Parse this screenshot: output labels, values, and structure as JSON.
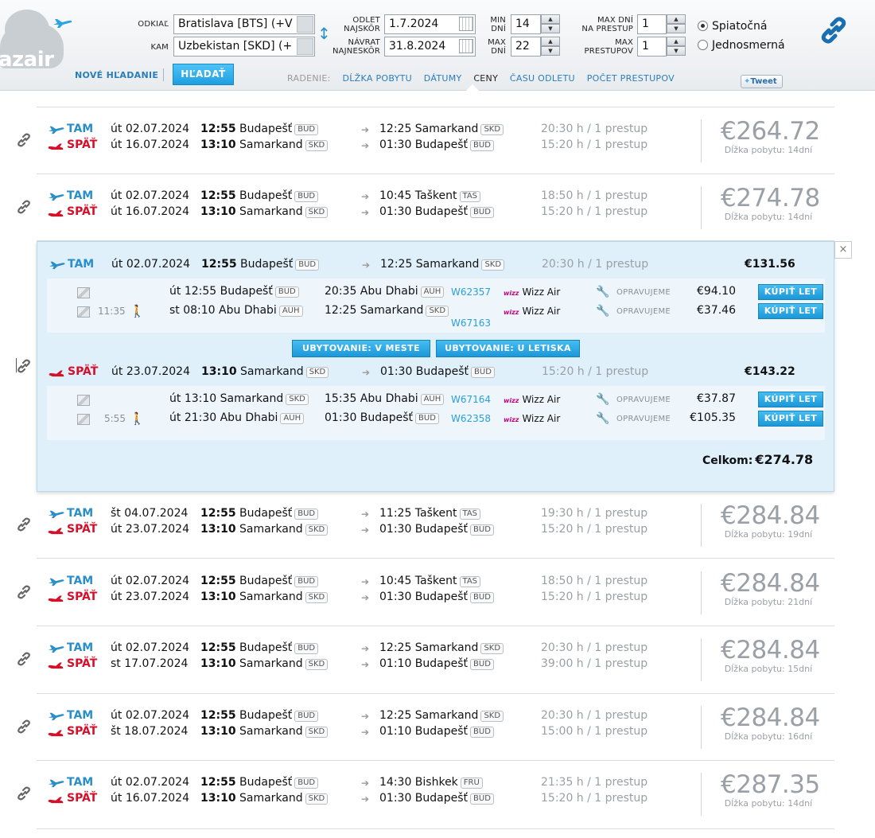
{
  "brand": {
    "logo_text": "azair"
  },
  "search": {
    "from_label": "ODKIAĽ",
    "from_value": "Bratislava [BTS] (+V",
    "to_label": "KAM",
    "to_value": "Uzbekistan [SKD] (+",
    "depart_label": [
      "ODLET",
      "NAJSKÔR"
    ],
    "depart_value": "1.7.2024",
    "return_label": [
      "NÁVRAT",
      "NAJNESKÔR"
    ],
    "return_value": "31.8.2024",
    "min_days_label": [
      "MIN",
      "DNÍ"
    ],
    "min_days_value": "14",
    "max_days_label": [
      "MAX",
      "DNÍ"
    ],
    "max_days_value": "22",
    "max_days_transfer_label": [
      "MAX DNÍ",
      "NA PRESTUP"
    ],
    "max_days_transfer_value": "1",
    "max_transfers_label": [
      "MAX",
      "PRESTUPOV"
    ],
    "max_transfers_value": "1",
    "trip_options": [
      "Spiatočná",
      "Jednosmerná"
    ],
    "trip_selected": "Spiatočná",
    "new_search": "NOVÉ HĽADANIE",
    "search_button": "HĽADAŤ"
  },
  "sorting": {
    "label": "RADENIE:",
    "items": [
      "DĹŽKA POBYTU",
      "DÁTUMY",
      "CENY",
      "ČASU ODLETU",
      "POČET PRESTUPOV"
    ],
    "active": "CENY"
  },
  "tweet": "Tweet",
  "labels": {
    "tam": "TAM",
    "spat": "SPÄŤ",
    "stay_prefix": "Dĺžka pobytu:",
    "fix": "OPRAVUJEME",
    "buy": "KÚPIŤ LET",
    "total": "Celkom:"
  },
  "results": [
    {
      "price": "€264.72",
      "stay": "Dĺžka pobytu: 14dní",
      "out": {
        "date": "út 02.07.2024",
        "time": "12:55",
        "from": "Budapešť",
        "from_code": "BUD",
        "arr": "12:25 Samarkand",
        "arr_code": "SKD",
        "dur": "20:30 h / 1 prestup"
      },
      "ret": {
        "date": "út 16.07.2024",
        "time": "13:10",
        "from": "Samarkand",
        "from_code": "SKD",
        "arr": "01:30 Budapešť",
        "arr_code": "BUD",
        "dur": "15:20 h / 1 prestup"
      }
    },
    {
      "price": "€274.78",
      "stay": "Dĺžka pobytu: 14dní",
      "out": {
        "date": "út 02.07.2024",
        "time": "12:55",
        "from": "Budapešť",
        "from_code": "BUD",
        "arr": "10:45 Taškent",
        "arr_code": "TAS",
        "dur": "18:50 h / 1 prestup"
      },
      "ret": {
        "date": "út 16.07.2024",
        "time": "13:10",
        "from": "Samarkand",
        "from_code": "SKD",
        "arr": "01:30 Budapešť",
        "arr_code": "BUD",
        "dur": "15:20 h / 1 prestup"
      }
    },
    {
      "price": "€284.84",
      "stay": "Dĺžka pobytu: 19dní",
      "out": {
        "date": "št 04.07.2024",
        "time": "12:55",
        "from": "Budapešť",
        "from_code": "BUD",
        "arr": "11:25 Taškent",
        "arr_code": "TAS",
        "dur": "19:30 h / 1 prestup"
      },
      "ret": {
        "date": "út 23.07.2024",
        "time": "13:10",
        "from": "Samarkand",
        "from_code": "SKD",
        "arr": "01:30 Budapešť",
        "arr_code": "BUD",
        "dur": "15:20 h / 1 prestup"
      }
    },
    {
      "price": "€284.84",
      "stay": "Dĺžka pobytu: 21dní",
      "out": {
        "date": "út 02.07.2024",
        "time": "12:55",
        "from": "Budapešť",
        "from_code": "BUD",
        "arr": "10:45 Taškent",
        "arr_code": "TAS",
        "dur": "18:50 h / 1 prestup"
      },
      "ret": {
        "date": "út 23.07.2024",
        "time": "13:10",
        "from": "Samarkand",
        "from_code": "SKD",
        "arr": "01:30 Budapešť",
        "arr_code": "BUD",
        "dur": "15:20 h / 1 prestup"
      }
    },
    {
      "price": "€284.84",
      "stay": "Dĺžka pobytu: 15dní",
      "out": {
        "date": "út 02.07.2024",
        "time": "12:55",
        "from": "Budapešť",
        "from_code": "BUD",
        "arr": "12:25 Samarkand",
        "arr_code": "SKD",
        "dur": "20:30 h / 1 prestup"
      },
      "ret": {
        "date": "st 17.07.2024",
        "time": "13:10",
        "from": "Samarkand",
        "from_code": "SKD",
        "arr": "01:10 Budapešť",
        "arr_code": "BUD",
        "dur": "39:00 h / 1 prestup"
      }
    },
    {
      "price": "€284.84",
      "stay": "Dĺžka pobytu: 16dní",
      "out": {
        "date": "út 02.07.2024",
        "time": "12:55",
        "from": "Budapešť",
        "from_code": "BUD",
        "arr": "12:25 Samarkand",
        "arr_code": "SKD",
        "dur": "20:30 h / 1 prestup"
      },
      "ret": {
        "date": "št 18.07.2024",
        "time": "13:10",
        "from": "Samarkand",
        "from_code": "SKD",
        "arr": "01:10 Budapešť",
        "arr_code": "BUD",
        "dur": "15:00 h / 1 prestup"
      }
    },
    {
      "price": "€287.35",
      "stay": "Dĺžka pobytu: 14dní",
      "out": {
        "date": "út 02.07.2024",
        "time": "12:55",
        "from": "Budapešť",
        "from_code": "BUD",
        "arr": "14:30 Bishkek",
        "arr_code": "FRU",
        "dur": "21:35 h / 1 prestup"
      },
      "ret": {
        "date": "út 16.07.2024",
        "time": "13:10",
        "from": "Samarkand",
        "from_code": "SKD",
        "arr": "01:30 Budapešť",
        "arr_code": "BUD",
        "dur": "15:20 h / 1 prestup"
      }
    }
  ],
  "expanded": {
    "close": "×",
    "out": {
      "date": "út 02.07.2024",
      "time": "12:55",
      "from": "Budapešť",
      "from_code": "BUD",
      "arr": "12:25 Samarkand",
      "arr_code": "SKD",
      "dur": "20:30 h / 1 prestup",
      "total": "€131.56",
      "segments": [
        {
          "layover": "",
          "dep": "út 12:55 Budapešť",
          "dep_code": "BUD",
          "arr": "20:35 Abu Dhabi",
          "arr_code": "AUH",
          "flight": "W62357",
          "airline": "Wizz Air",
          "price": "€94.10"
        },
        {
          "layover": "11:35",
          "dep": "st 08:10 Abu Dhabi",
          "dep_code": "AUH",
          "arr": "12:25 Samarkand",
          "arr_code": "SKD",
          "flight": "W67163",
          "airline": "Wizz Air",
          "price": "€37.46"
        }
      ]
    },
    "ret": {
      "date": "út 23.07.2024",
      "time": "13:10",
      "from": "Samarkand",
      "from_code": "SKD",
      "arr": "01:30 Budapešť",
      "arr_code": "BUD",
      "dur": "15:20 h / 1 prestup",
      "total": "€143.22",
      "segments": [
        {
          "layover": "",
          "dep": "út 13:10 Samarkand",
          "dep_code": "SKD",
          "arr": "15:35 Abu Dhabi",
          "arr_code": "AUH",
          "flight": "W67164",
          "airline": "Wizz Air",
          "price": "€37.87"
        },
        {
          "layover": "5:55",
          "dep": "út 21:30 Abu Dhabi",
          "dep_code": "AUH",
          "arr": "01:30 Budapešť",
          "arr_code": "BUD",
          "flight": "W62358",
          "airline": "Wizz Air",
          "price": "€105.35"
        }
      ]
    },
    "hotel_city": "UBYTOVANIE: V MESTE",
    "hotel_airport": "UBYTOVANIE: U LETISKA",
    "total_price": "€274.78"
  }
}
